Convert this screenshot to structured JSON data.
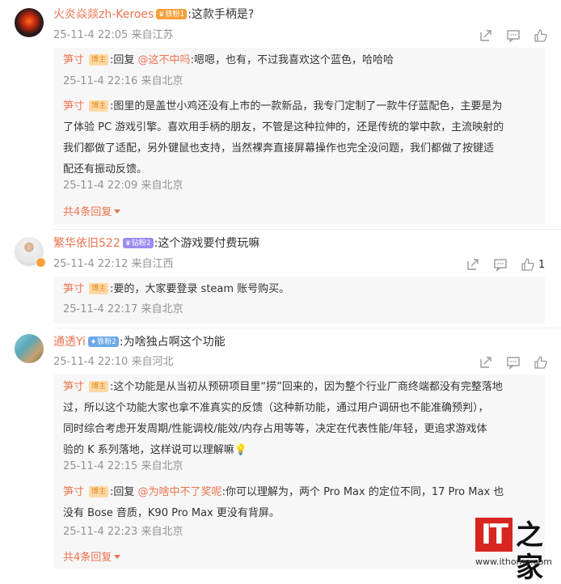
{
  "comments": [
    {
      "user": "火炎焱燚zh-Keroes",
      "badge": "铁粉1",
      "text": ":这款手柄是?",
      "meta": "25-11-4 22:05 来自江苏",
      "likes": "",
      "replies": [
        {
          "name": "笋寸",
          "tag": "博主",
          "prefix": ":回复 ",
          "mention": "@这不中吗",
          "text": ":嗯嗯，也有，不过我喜欢这个蓝色，哈哈哈",
          "meta": "25-11-4 22:16 来自北京"
        },
        {
          "name": "笋寸",
          "tag": "博主",
          "lines": [
            ":图里的是盖世小鸡还没有上市的一款新品，我专门定制了一款牛仔蓝配色，主要是为",
            "了体验 PC 游戏引擎。喜欢用手柄的朋友，不管是这种拉伸的，还是传统的掌中款，主流映射的",
            "我们都做了适配，另外键鼠也支持，当然裸奔直接屏幕操作也完全没问题，我们都做了按键适",
            "配还有振动反馈。"
          ],
          "meta": "25-11-4 22:09 来自北京"
        }
      ],
      "more": "共4条回复"
    },
    {
      "user": "繁华依旧522",
      "badge": "钻粉2",
      "text": ":这个游戏要付费玩嘛",
      "meta": "25-11-4 22:12 来自江西",
      "likes": "1",
      "replies": [
        {
          "name": "笋寸",
          "tag": "博主",
          "text": ":要的，大家要登录 steam 账号购买。",
          "meta": "25-11-4 22:17 来自北京"
        }
      ]
    },
    {
      "user": "通透Yi",
      "badge": "铁粉2",
      "text": ":为啥独占啊这个功能",
      "meta": "25-11-4 22:10 来自河北",
      "likes": "",
      "replies": [
        {
          "name": "笋寸",
          "tag": "博主",
          "lines": [
            ":这个功能是从当初从预研项目里“捞”回来的，因为整个行业厂商终端都没有完整落地",
            "过，所以这个功能大家也拿不准真实的反馈（这种新功能，通过用户调研也不能准确预判），",
            "同时综合考虑开发周期/性能调校/能效/内存占用等等，决定在代表性能/年轻，更追求游戏体",
            "验的 K 系列落地，这样说可以理解嘛💡"
          ],
          "meta": "25-11-4 22:15 来自北京"
        },
        {
          "name": "笋寸",
          "tag": "博主",
          "prefix": ":回复 ",
          "mention": "@为啥中不了奖呢",
          "lines": [
            ":你可以理解为，两个 Pro Max 的定位不同，17 Pro Max 也",
            "没有 Bose 音质，K90 Pro Max 更没有背屏。"
          ],
          "meta": "25-11-4 22:23 来自北京"
        }
      ],
      "more": "共4条回复"
    }
  ],
  "watermark": {
    "logo": "IT",
    "glyph": "之家",
    "url": "www.ithome.com"
  },
  "colors": {
    "accent": "#eb7350",
    "meta": "#939393",
    "reply_bg": "#f7f7f7"
  }
}
